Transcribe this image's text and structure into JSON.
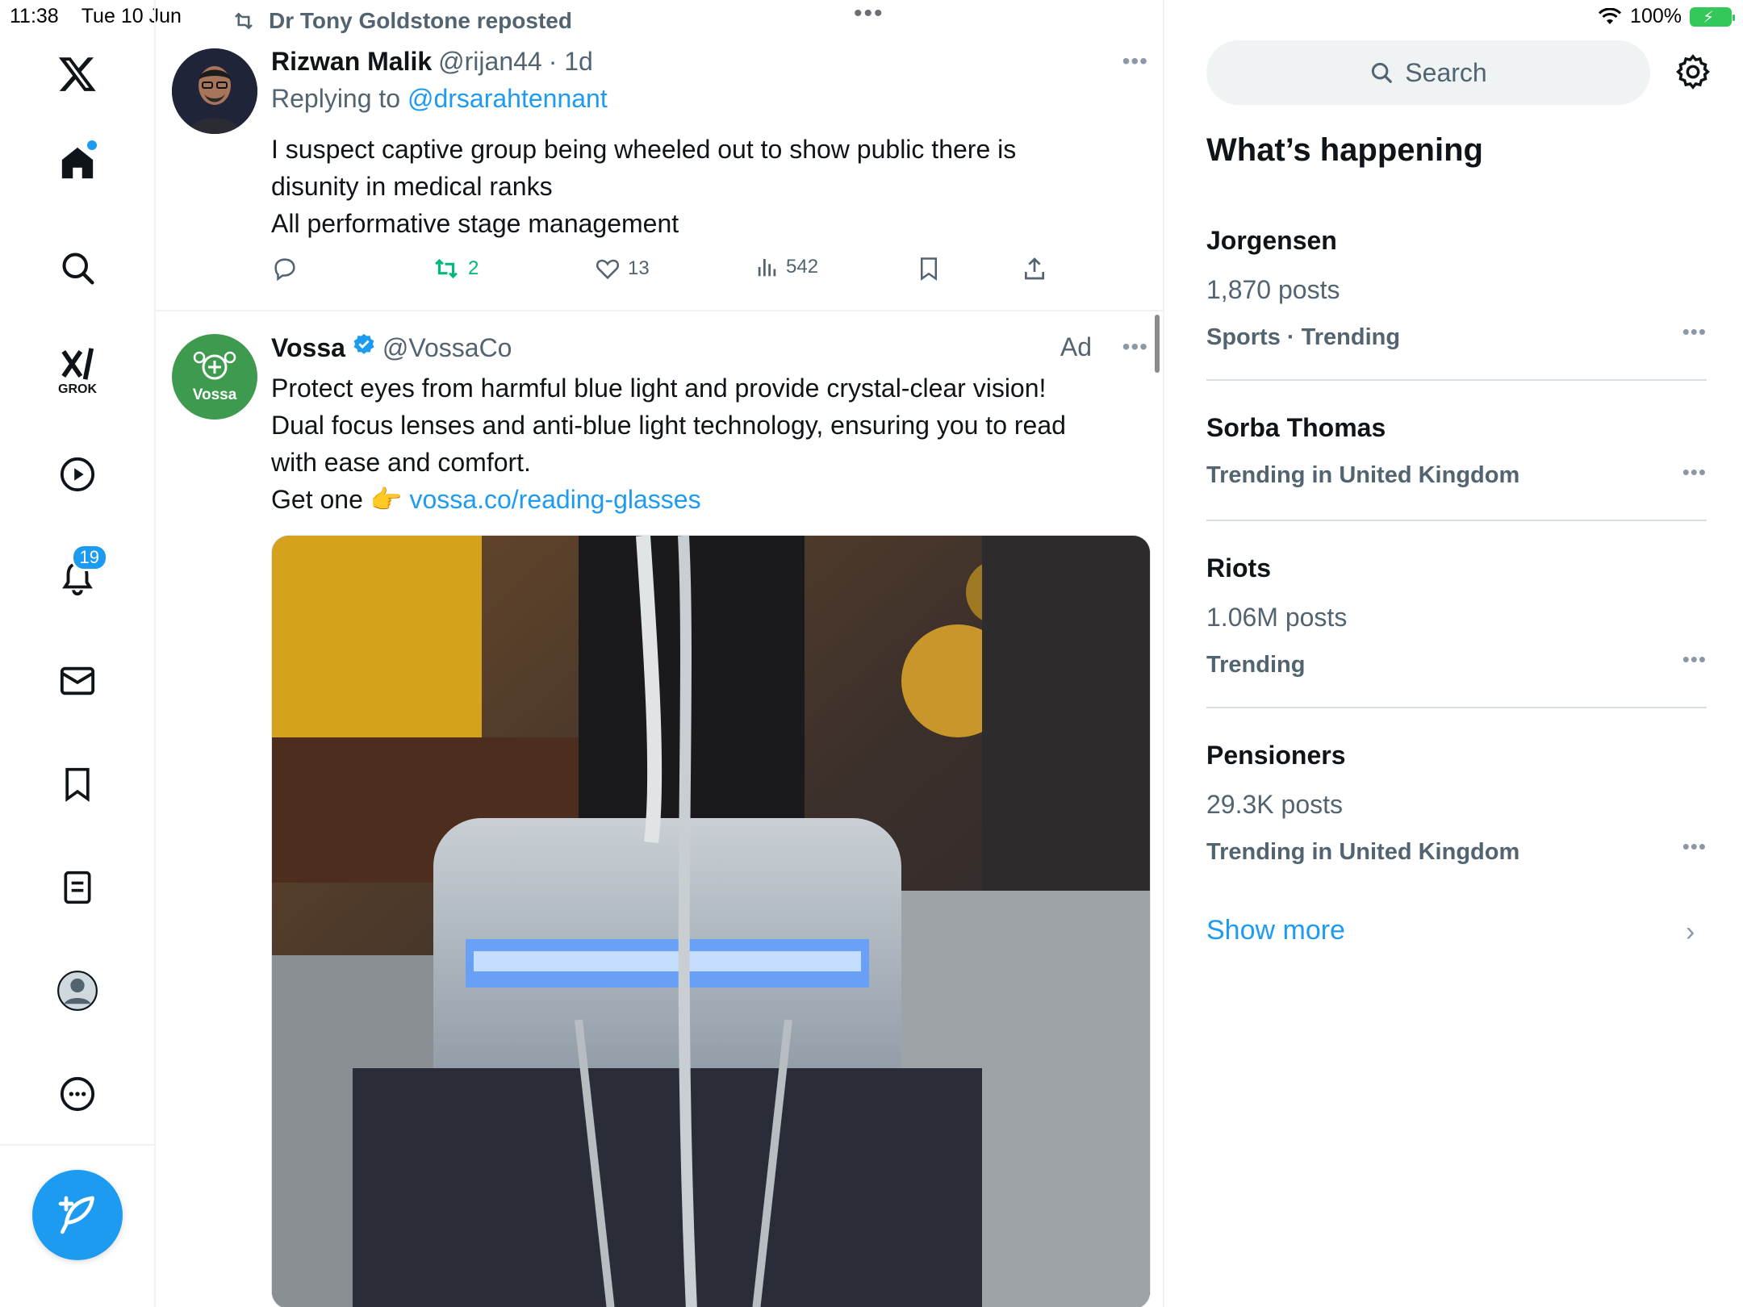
{
  "status_bar": {
    "time": "11:38",
    "date": "Tue 10 Jun",
    "battery": "100%"
  },
  "nav": {
    "logo": "x-logo-icon",
    "grok_label": "GROK",
    "notifications_count": "19",
    "items": [
      "home-icon",
      "search-icon",
      "grok-icon",
      "video-icon",
      "bell-icon",
      "mail-icon",
      "bookmark-icon",
      "list-icon",
      "profile-icon",
      "more-icon"
    ]
  },
  "feed": {
    "tweet1": {
      "repost_by": "Dr Tony Goldstone reposted",
      "name": "Rizwan Malik",
      "handle": "@rijan44",
      "time": "· 1d",
      "replying_prefix": "Replying to",
      "replying_to": "@drsarahtennant",
      "text_line1": "I suspect captive group being wheeled out to show public there is",
      "text_line2": "disunity in medical ranks",
      "text_line3": "All performative stage management",
      "reposts": "2",
      "likes": "13",
      "views": "542"
    },
    "tweet2": {
      "avatar_text": "Vossa",
      "name": "Vossa",
      "handle": "@VossaCo",
      "ad_label": "Ad",
      "text_line1": "Protect eyes from harmful blue light and provide crystal-clear vision!",
      "text_line2": "Dual focus lenses and anti-blue light technology, ensuring you to read",
      "text_line3": "with ease and comfort.",
      "text_line4_prefix": "Get one",
      "emoji": "👉",
      "link": "vossa.co/reading-glasses"
    }
  },
  "sidebar": {
    "search_placeholder": "Search",
    "section_title": "What’s happening",
    "trends": [
      {
        "name": "Jorgensen",
        "count": "1,870 posts",
        "category": "Sports · Trending"
      },
      {
        "name": "Sorba Thomas",
        "count": "",
        "category": "Trending in United Kingdom"
      },
      {
        "name": "Riots",
        "count": "1.06M posts",
        "category": "Trending"
      },
      {
        "name": "Pensioners",
        "count": "29.3K posts",
        "category": "Trending in United Kingdom"
      }
    ],
    "show_more": "Show more"
  },
  "colors": {
    "accent": "#1d9bf0",
    "repost_green": "#00ba7c",
    "secondary_text": "#536471",
    "vossa_green": "#3d9a4f"
  }
}
